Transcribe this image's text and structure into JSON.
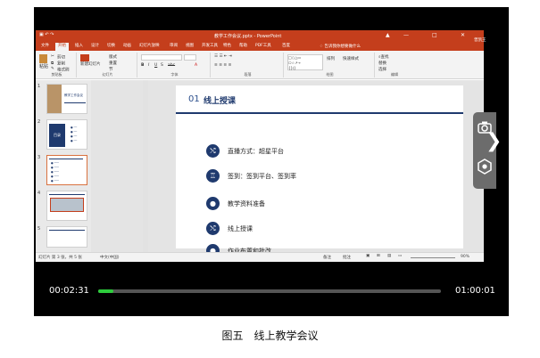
{
  "window": {
    "title": "教学工作会议.pptx - PowerPoint",
    "controls": [
      "▲",
      "—",
      "□",
      "✕"
    ],
    "user": "曾凯王"
  },
  "menu": {
    "tabs": [
      "文件",
      "开始",
      "插入",
      "设计",
      "切换",
      "动画",
      "幻灯片放映",
      "审阅",
      "视图",
      "开发工具",
      "特色",
      "帮助",
      "PDF工具",
      "百度"
    ],
    "active_tab": "开始",
    "search": "告诉我你想要做什么"
  },
  "ribbon": {
    "groups": [
      "剪贴板",
      "幻灯片",
      "字体",
      "段落",
      "绘图",
      "编辑"
    ],
    "paste": "粘贴",
    "cut": "剪切",
    "copy": "复制",
    "format_painter": "格式刷",
    "new_slide": "新建幻灯片",
    "layout": "版式",
    "reset": "重置",
    "section": "节",
    "shapes": "形状",
    "arrange": "排列",
    "quick_styles": "快速样式",
    "find": "查找",
    "replace": "替换",
    "select": "选择"
  },
  "thumbnails": {
    "numbers": [
      "1",
      "2",
      "3",
      "4",
      "5"
    ],
    "t1_title": "教学工作会议",
    "t2_label": "目录"
  },
  "slide": {
    "number": "01",
    "title": "线上授课",
    "items": [
      {
        "icon": "shuffle-icon",
        "glyph": "⤭",
        "text": "直播方式：超星平台"
      },
      {
        "icon": "trophy-icon",
        "glyph": "♖",
        "text": "签到：签到平台、签到率"
      },
      {
        "icon": "user-icon",
        "glyph": "●",
        "text": "教学资料准备"
      },
      {
        "icon": "shuffle-icon",
        "glyph": "⤭",
        "text": "线上授课"
      },
      {
        "icon": "user-icon",
        "glyph": "●",
        "text": "作业布置和批改"
      }
    ]
  },
  "statusbar": {
    "slide_info": "幻灯片 第 3 张，共 5 张",
    "language": "中文(中国)",
    "notes": "备注",
    "comments": "批注",
    "zoom": "90%"
  },
  "player": {
    "current_time": "00:02:31",
    "total_time": "01:00:01",
    "progress": 0.045,
    "accent": "#2dcc3c"
  },
  "caption": "图五　线上教学会议"
}
